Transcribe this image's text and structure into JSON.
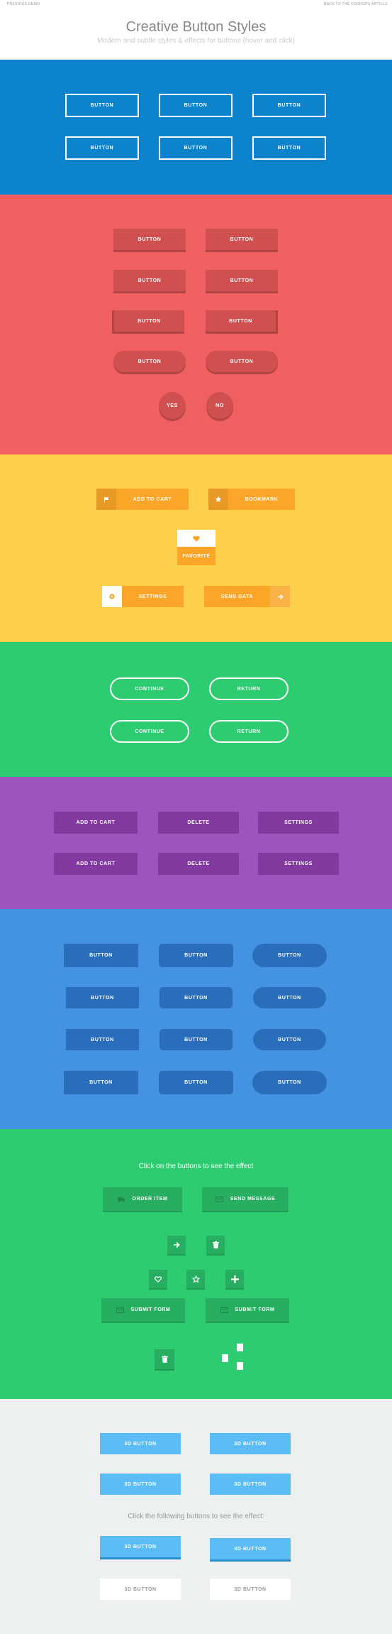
{
  "topbar": {
    "left": "Previous Demo",
    "right": "Back to the Codrops Article"
  },
  "header": {
    "title": "Creative Button Styles",
    "subtitle": "Modern and subtle styles & effects for buttons (hover and click)"
  },
  "s1": {
    "buttons": [
      "Button",
      "Button",
      "Button",
      "Button",
      "Button",
      "Button"
    ]
  },
  "s2": {
    "buttons": [
      "Button",
      "Button",
      "Button",
      "Button",
      "Button",
      "Button",
      "Button",
      "Button"
    ],
    "yes": "Yes",
    "no": "No"
  },
  "s3": {
    "add_to_cart": "Add to Cart",
    "bookmark": "Bookmark",
    "favorite": "Favorite",
    "settings": "Settings",
    "send_data": "Send Data"
  },
  "s4": {
    "continue": "Continue",
    "return": "Return"
  },
  "s5": {
    "add_to_cart": "Add to Cart",
    "delete": "Delete",
    "settings": "Settings"
  },
  "s6": {
    "button": "Button"
  },
  "s7": {
    "caption": "Click on the buttons to see the effect",
    "order_item": "Order Item",
    "send_message": "Send Message",
    "submit_form": "Submit Form"
  },
  "s8": {
    "button": "3D Button",
    "caption": "Click the following buttons to see the effect:"
  },
  "colors": {
    "blue": "#0e83cd",
    "red": "#f06060",
    "yellow": "#fcd04b",
    "green": "#2ecc71",
    "purple": "#9e54bd",
    "skyblue": "#4493e2",
    "grey": "#ecf0f1"
  }
}
